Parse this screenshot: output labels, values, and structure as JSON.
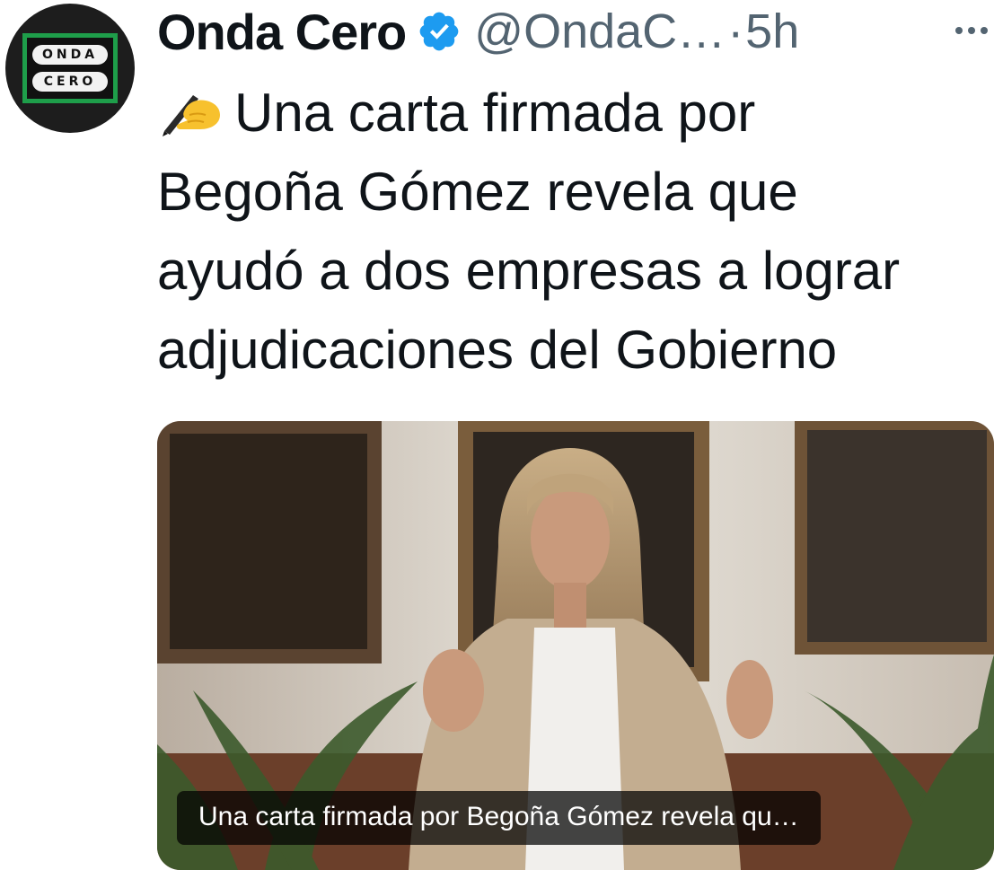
{
  "tweet": {
    "display_name": "Onda Cero",
    "verified_icon": "verified-badge-icon",
    "handle": "@OndaC…",
    "separator": "·",
    "time": "5h",
    "more_icon": "more-horizontal-icon",
    "text": "Una carta firmada por\nBegoña Gómez revela que\nayudó a dos empresas a lograr\nadjudicaciones del Gobierno",
    "emoji": "writing-hand-emoji",
    "avatar": {
      "logo_text_top": "ONDA",
      "logo_text_bottom": "CERO",
      "logo_color": "#1e9e4a"
    },
    "media": {
      "caption": "Una carta firmada por Begoña Gómez revela qu…"
    }
  },
  "colors": {
    "text": "#0f1419",
    "secondary": "#536471",
    "verified": "#1d9bf0"
  }
}
